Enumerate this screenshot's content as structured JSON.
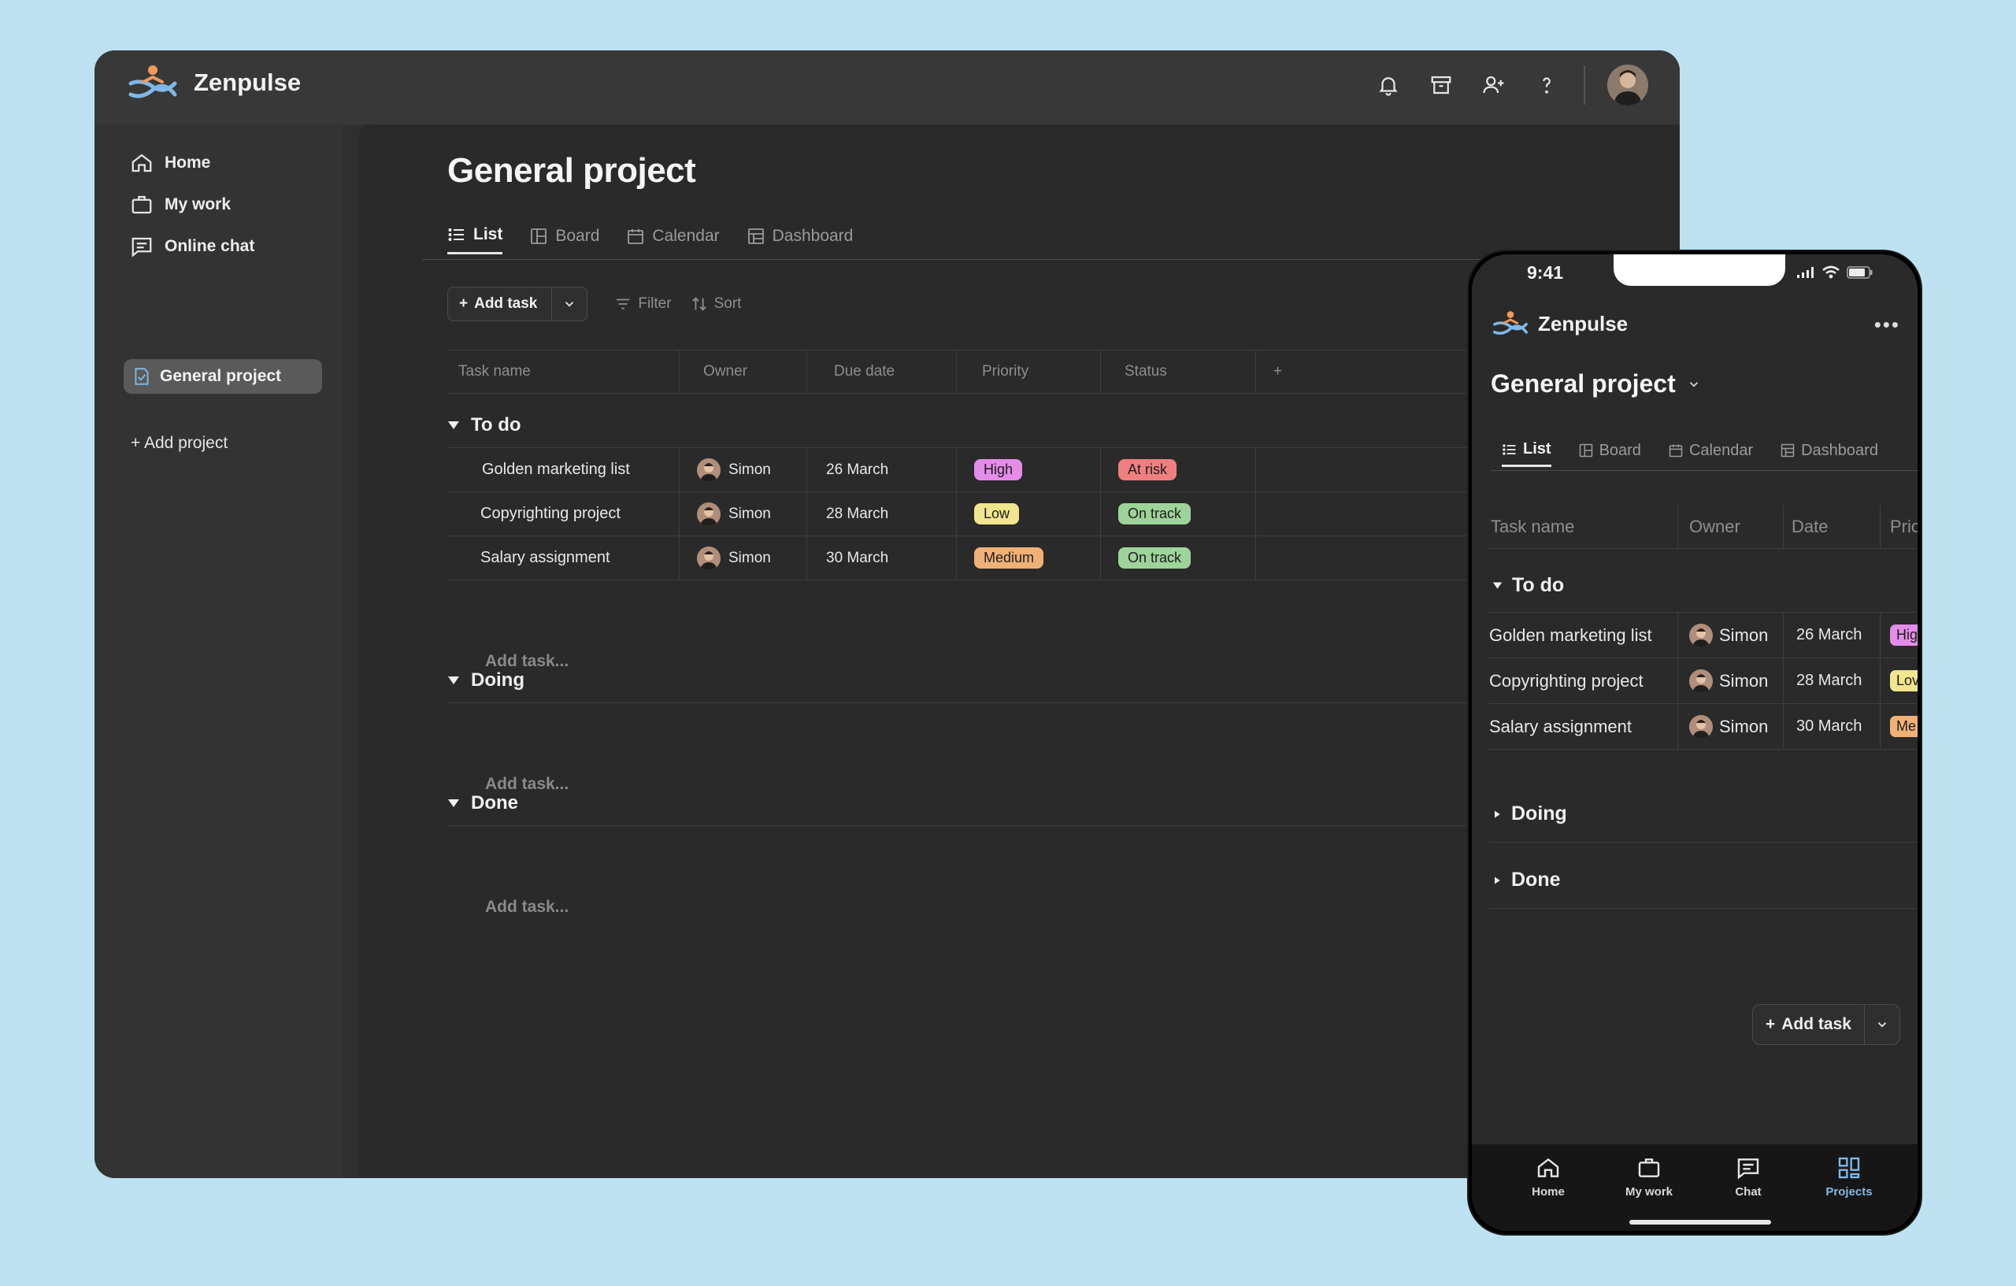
{
  "brand": {
    "name": "Zenpulse",
    "accent": "#7fb8e8"
  },
  "header": {
    "icons": [
      "bell-icon",
      "archive-icon",
      "add-user-icon",
      "help-icon"
    ],
    "avatar": "user-avatar"
  },
  "sidebar": {
    "items": [
      {
        "label": "Home",
        "icon": "home-icon"
      },
      {
        "label": "My work",
        "icon": "briefcase-icon"
      },
      {
        "label": "Online chat",
        "icon": "chat-icon"
      }
    ],
    "active_project": "General project",
    "add_project": "+ Add project"
  },
  "main": {
    "title": "General project",
    "tabs": [
      {
        "label": "List",
        "active": true
      },
      {
        "label": "Board"
      },
      {
        "label": "Calendar"
      },
      {
        "label": "Dashboard"
      }
    ],
    "toolbar": {
      "add_task": "Add task",
      "filter": "Filter",
      "sort": "Sort"
    },
    "columns": [
      "Task name",
      "Owner",
      "Due date",
      "Priority",
      "Status",
      "+"
    ],
    "groups": [
      {
        "name": "To do",
        "tasks": [
          {
            "name": "Golden marketing list",
            "owner": "Simon",
            "due": "26 March",
            "priority": "High",
            "status": "At risk"
          },
          {
            "name": "Copyrighting project",
            "owner": "Simon",
            "due": "28 March",
            "priority": "Low",
            "status": "On track"
          },
          {
            "name": "Salary assignment",
            "owner": "Simon",
            "due": "30 March",
            "priority": "Medium",
            "status": "On track"
          }
        ]
      },
      {
        "name": "Doing",
        "tasks": []
      },
      {
        "name": "Done",
        "tasks": []
      }
    ],
    "add_task_placeholder": "Add task..."
  },
  "colors": {
    "High": "#e38ce8",
    "Low": "#f1e58e",
    "Medium": "#f0b176",
    "At risk": "#f07f7f",
    "On track": "#9ed39a"
  },
  "phone": {
    "time": "9:41",
    "title": "General project",
    "tabs": [
      "List",
      "Board",
      "Calendar",
      "Dashboard"
    ],
    "columns": [
      "Task name",
      "Owner",
      "Date",
      "Prior"
    ],
    "tasks": [
      {
        "name": "Golden marketing list",
        "owner": "Simon",
        "date": "26 March",
        "priority": "Hig"
      },
      {
        "name": "Copyrighting project",
        "owner": "Simon",
        "date": "28 March",
        "priority": "Lov"
      },
      {
        "name": "Salary assignment",
        "owner": "Simon",
        "date": "30 March",
        "priority": "Me"
      }
    ],
    "groups": [
      "To do",
      "Doing",
      "Done"
    ],
    "add_task": "Add task",
    "nav": [
      {
        "label": "Home",
        "icon": "home-icon"
      },
      {
        "label": "My work",
        "icon": "briefcase-icon"
      },
      {
        "label": "Chat",
        "icon": "chat-icon"
      },
      {
        "label": "Projects",
        "icon": "projects-icon",
        "active": true
      }
    ]
  }
}
